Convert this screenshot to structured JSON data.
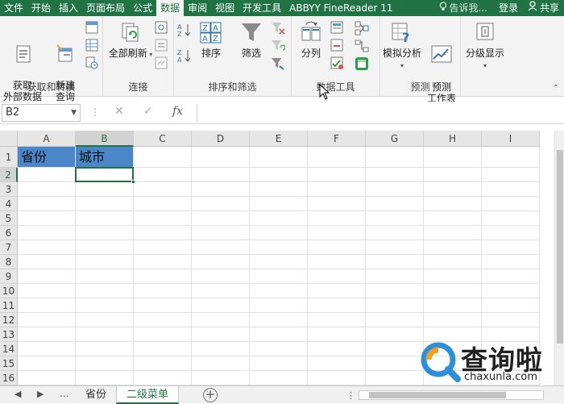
{
  "tabs": [
    "文件",
    "开始",
    "插入",
    "页面布局",
    "公式",
    "数据",
    "审阅",
    "视图",
    "开发工具",
    "ABBYY FineReader 11"
  ],
  "active_tab": "数据",
  "tell_me": "告诉我...",
  "login": "登录",
  "share": "共享",
  "ribbon": {
    "get_external_data": "获取\n外部数据",
    "new_query": "新建\n查询",
    "group_get_transform": "获取和转换",
    "refresh_all": "全部刷新",
    "group_connections": "连接",
    "sort": "排序",
    "filter": "筛选",
    "group_sort_filter": "排序和筛选",
    "text_to_columns": "分列",
    "group_data_tools": "数据工具",
    "what_if": "模拟分析",
    "forecast_sheet": "预测\n工作表",
    "group_forecast": "预测",
    "outline": "分级显示"
  },
  "formula_bar": {
    "name_box": "B2",
    "fx": "fx",
    "formula": ""
  },
  "grid": {
    "columns": [
      "A",
      "B",
      "C",
      "D",
      "E",
      "F",
      "G",
      "H",
      "I"
    ],
    "rows": [
      "1",
      "2",
      "3",
      "4",
      "5",
      "6",
      "7",
      "8",
      "9",
      "10",
      "11",
      "12",
      "13",
      "14",
      "15",
      "16"
    ],
    "cells": {
      "A1": "省份",
      "B1": "城市"
    },
    "selected_cell": "B2",
    "header_fill_color": "#4a86c8"
  },
  "sheets": {
    "ellipsis": "...",
    "tabs": [
      "省份",
      "二级菜单"
    ],
    "active": "二级菜单"
  },
  "watermark": {
    "text": "查询啦",
    "url": "chaxunla.com"
  },
  "colors": {
    "accent": "#217346",
    "selection_fill": "#4a86c8"
  }
}
